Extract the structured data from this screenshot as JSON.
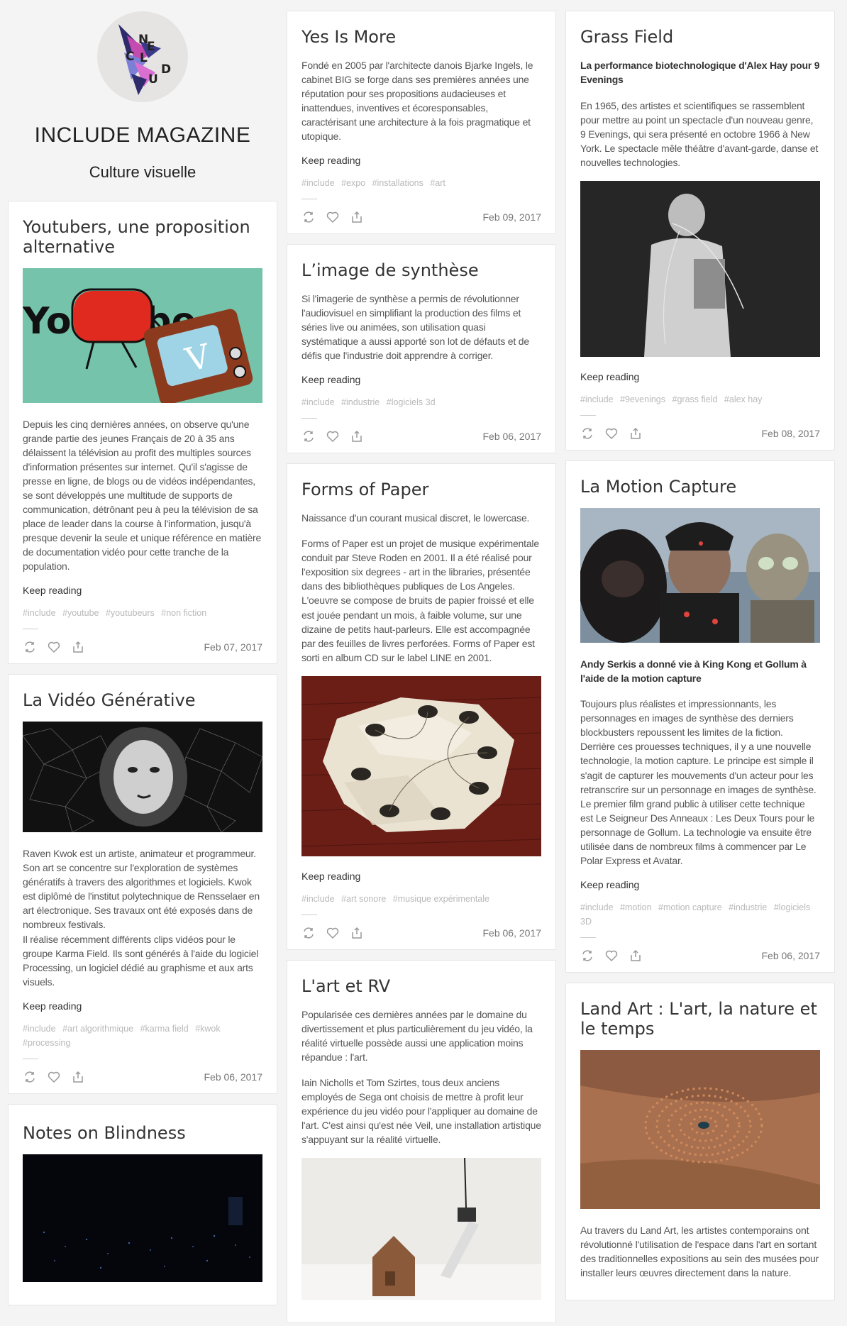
{
  "site": {
    "title": "INCLUDE MAGAZINE",
    "tagline": "Culture visuelle",
    "logo_letters": [
      "N",
      "C",
      "L",
      "U",
      "D",
      "E"
    ]
  },
  "ui": {
    "keep_reading": "Keep reading"
  },
  "icons": {
    "reblog": "repeat-icon",
    "like": "heart-icon",
    "share": "share-icon"
  },
  "colors": {
    "tag": "#b9b9b9",
    "card_bg": "#ffffff",
    "page_bg": "#f4f4f4"
  },
  "posts": {
    "youtubers": {
      "title": "Youtubers, une proposition alternative",
      "text": "Depuis les cinq dernières années, on observe qu'une grande partie des jeunes Français de 20 à 35 ans délaissent la télévision au profit des multiples sources d'information présentes sur internet. Qu'il s'agisse de presse en ligne, de blogs ou de vidéos indépendantes, se sont développés une multitude de supports de communication, détrônant peu à peu la télévision de sa place de leader dans la course à l'information, jusqu'à presque devenir la seule et unique référence en matière de documentation vidéo pour cette tranche de la population.",
      "image_text": "YouTube",
      "tags": [
        "#include",
        "#youtube",
        "#youtubeurs",
        "#non fiction"
      ],
      "date": "Feb 07, 2017"
    },
    "generative": {
      "title": "La Vidéo Générative",
      "text": "Raven Kwok est un artiste, animateur et programmeur. Son art se concentre sur l'exploration de systèmes génératifs à travers des algorithmes et logiciels. Kwok est diplômé de l'institut polytechnique de Rensselaer en art électronique. Ses travaux ont été exposés dans de nombreux festivals.",
      "text2": "Il réalise récemment différents clips vidéos pour le groupe Karma Field. Ils sont générés à l'aide du logiciel Processing, un logiciel dédié au graphisme et aux arts visuels.",
      "tags": [
        "#include",
        "#art algorithmique",
        "#karma field",
        "#kwok",
        "#processing"
      ],
      "date": "Feb 06, 2017"
    },
    "blindness": {
      "title": "Notes on Blindness"
    },
    "yes": {
      "title": "Yes Is More",
      "text": "Fondé en 2005 par l'architecte danois Bjarke Ingels, le cabinet BIG se forge dans ses premières années une réputation pour ses propositions audacieuses et inattendues, inventives et écoresponsables, caractérisant une architecture à la fois pragmatique et utopique.",
      "tags": [
        "#include",
        "#expo",
        "#installations",
        "#art"
      ],
      "date": "Feb 09, 2017"
    },
    "synthese": {
      "title": "L’image de synthèse",
      "text": "Si l'imagerie de synthèse a permis de révolutionner l'audiovisuel en simplifiant la production des films et séries live ou animées, son utilisation quasi systématique a aussi apporté son lot de défauts et de défis que l'industrie doit apprendre à corriger.",
      "tags": [
        "#include",
        "#industrie",
        "#logiciels 3d"
      ],
      "date": "Feb 06, 2017"
    },
    "paper": {
      "title": "Forms of Paper",
      "intro": "Naissance d'un courant musical discret, le lowercase.",
      "text": "Forms of Paper est un projet de musique expérimentale conduit par Steve Roden en 2001. Il a été réalisé pour l'exposition six degrees - art in the libraries, présentée dans des bibliothèques publiques de Los Angeles. L'oeuvre se compose de bruits de papier froissé et elle est jouée pendant un mois, à faible volume, sur une dizaine de petits haut-parleurs. Elle est accompagnée par des feuilles de livres perforées. Forms of Paper est sorti en album CD sur le label LINE en 2001.",
      "tags": [
        "#include",
        "#art sonore",
        "#musique expérimentale"
      ],
      "date": "Feb 06, 2017"
    },
    "rv": {
      "title": "L'art et RV",
      "text": "Popularisée ces dernières années par le domaine du divertissement et plus particulièrement du jeu vidéo, la réalité virtuelle possède aussi une application moins répandue : l'art.",
      "text2": "Iain Nicholls et Tom Szirtes, tous deux anciens employés de Sega ont choisis de mettre à profit leur expérience du jeu vidéo pour l'appliquer au domaine de l'art. C'est ainsi qu'est née Veil, une installation artistique s'appuyant sur la réalité virtuelle."
    },
    "grass": {
      "title": "Grass Field",
      "subtitle": "La performance biotechnologique d'Alex Hay pour 9 Evenings",
      "text": "En 1965, des artistes et scientifiques se rassemblent pour mettre au point un spectacle d'un nouveau genre, 9 Evenings, qui sera présenté en octobre 1966 à New York. Le spectacle mêle théâtre d'avant-garde, danse et nouvelles technologies.",
      "tags": [
        "#include",
        "#9evenings",
        "#grass field",
        "#alex hay"
      ],
      "date": "Feb 08, 2017"
    },
    "motion": {
      "title": "La Motion Capture",
      "subtitle": "Andy Serkis a donné vie à King Kong et Gollum à l'aide de la motion capture",
      "text": "Toujours plus réalistes et impressionnants, les personnages en images de synthèse des derniers blockbusters repoussent les limites de la fiction. Derrière ces prouesses techniques, il y a une nouvelle technologie, la motion capture. Le principe est simple il s'agit de capturer les mouvements d'un acteur pour les retranscrire sur un personnage en images de synthèse. Le premier film grand public à utiliser cette technique est Le Seigneur Des Anneaux : Les Deux Tours pour le personnage de Gollum. La technologie va ensuite être utilisée dans de nombreux films à commencer par Le Polar Express et Avatar.",
      "tags": [
        "#include",
        "#motion",
        "#motion capture",
        "#industrie",
        "#logiciels 3D"
      ],
      "date": "Feb 06, 2017"
    },
    "landart": {
      "title": "Land Art : L'art, la nature et le temps",
      "text": "Au travers du Land Art, les artistes contemporains ont révolutionné l'utilisation de l'espace dans l'art en sortant des traditionnelles expositions au sein des musées pour installer leurs œuvres directement dans la nature."
    }
  }
}
